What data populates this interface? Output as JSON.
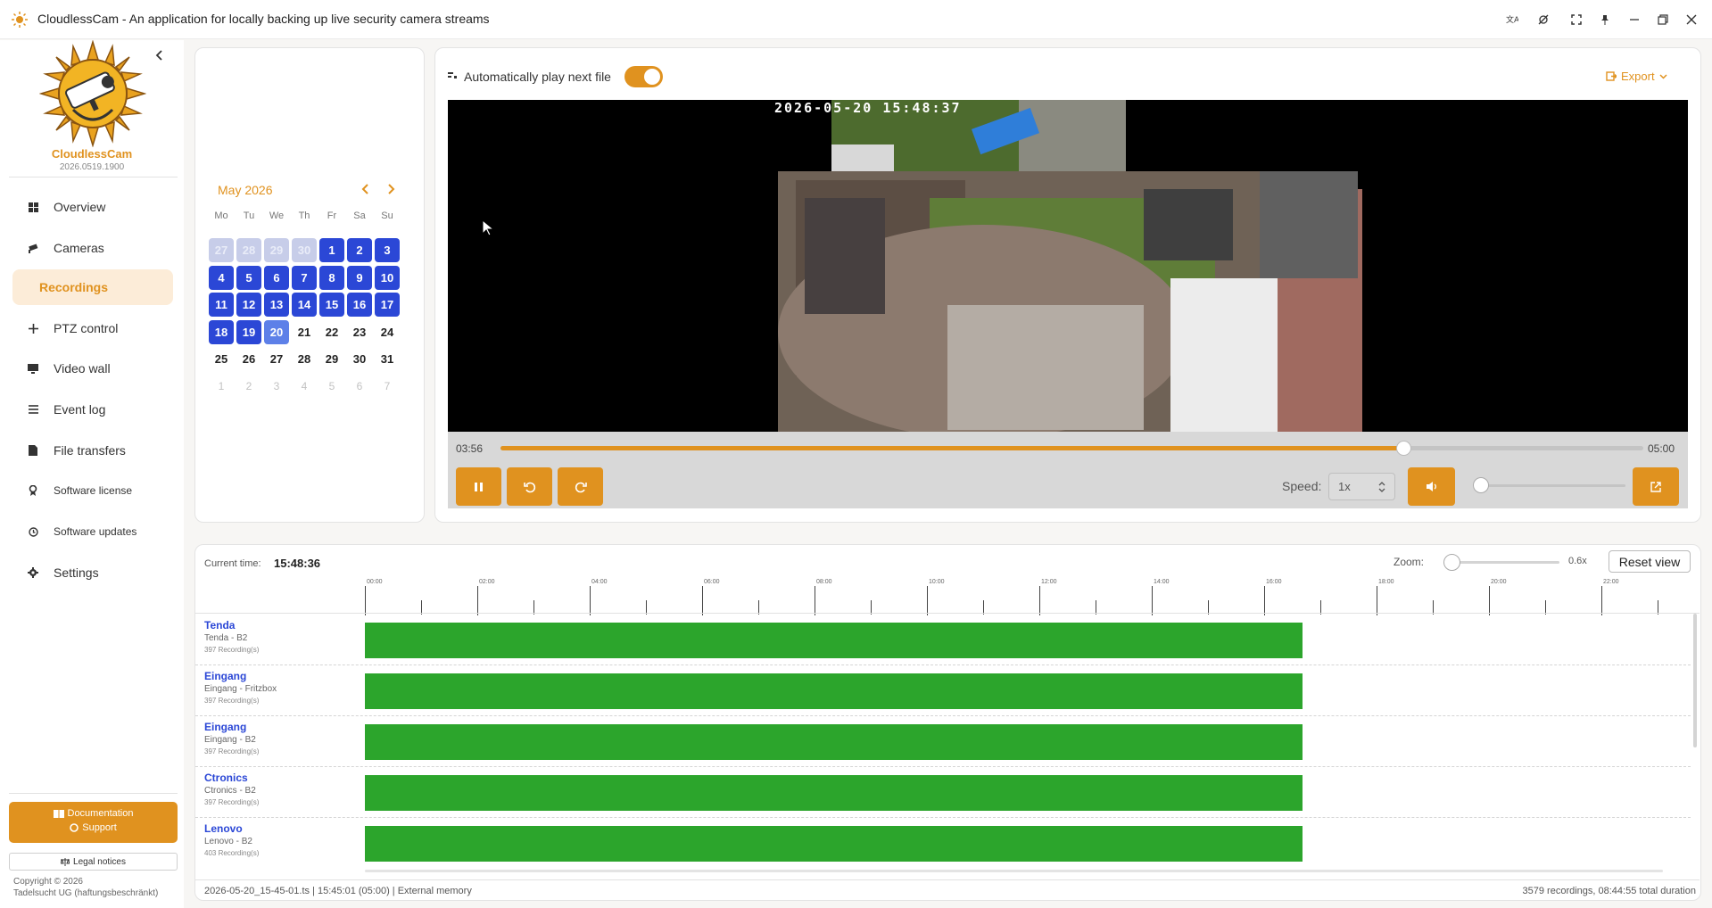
{
  "app": {
    "title": "CloudlessCam - An application for locally backing up live security camera streams"
  },
  "sidebar": {
    "brand": "CloudlessCam",
    "version": "2026.0519.1900",
    "items": [
      {
        "label": "Overview",
        "icon": "grid-icon"
      },
      {
        "label": "Cameras",
        "icon": "camera-icon"
      },
      {
        "label": "Recordings",
        "icon": "recordings-icon"
      },
      {
        "label": "PTZ control",
        "icon": "move-icon"
      },
      {
        "label": "Video wall",
        "icon": "monitor-icon"
      },
      {
        "label": "Event log",
        "icon": "list-icon"
      },
      {
        "label": "File transfers",
        "icon": "file-icon"
      },
      {
        "label": "Software license",
        "icon": "license-icon"
      },
      {
        "label": "Software updates",
        "icon": "update-icon"
      },
      {
        "label": "Settings",
        "icon": "gear-icon"
      }
    ],
    "documentation": "Documentation",
    "support": "Support",
    "legal": "Legal notices",
    "copyright1": "Copyright © 2026",
    "copyright2": "Tadelsucht UG (haftungsbeschränkt)"
  },
  "calendar": {
    "month": "May 2026",
    "weekdays": [
      "Mo",
      "Tu",
      "We",
      "Th",
      "Fr",
      "Sa",
      "Su"
    ],
    "weeks": [
      [
        "27",
        "28",
        "29",
        "30",
        "1",
        "2",
        "3"
      ],
      [
        "4",
        "5",
        "6",
        "7",
        "8",
        "9",
        "10"
      ],
      [
        "11",
        "12",
        "13",
        "14",
        "15",
        "16",
        "17"
      ],
      [
        "18",
        "19",
        "20",
        "21",
        "22",
        "23",
        "24"
      ],
      [
        "25",
        "26",
        "27",
        "28",
        "29",
        "30",
        "31"
      ],
      [
        "1",
        "2",
        "3",
        "4",
        "5",
        "6",
        "7"
      ]
    ],
    "selected": "20"
  },
  "player": {
    "autoplay_label": "Automatically play next file",
    "autoplay_on": true,
    "export_label": "Export",
    "overlay_timestamp": "2026-05-20 15:48:37",
    "elapsed": "03:56",
    "duration": "05:00",
    "progress": 0.79,
    "speed_label": "Speed:",
    "speed_value": "1x",
    "volume": 0.0
  },
  "timeline": {
    "current_time_label": "Current time:",
    "current_time": "15:48:36",
    "zoom_label": "Zoom:",
    "zoom_value": "0.6x",
    "reset_label": "Reset view",
    "hours": [
      "00:00",
      "02:00",
      "04:00",
      "06:00",
      "08:00",
      "10:00",
      "12:00",
      "14:00",
      "16:00",
      "18:00",
      "20:00",
      "22:00"
    ],
    "cameras": [
      {
        "name": "Tenda",
        "sub": "Tenda - B2",
        "count": "397 Recording(s)",
        "end_hour": 16.68
      },
      {
        "name": "Eingang",
        "sub": "Eingang - Fritzbox",
        "count": "397 Recording(s)",
        "end_hour": 16.68
      },
      {
        "name": "Eingang",
        "sub": "Eingang - B2",
        "count": "397 Recording(s)",
        "end_hour": 16.68
      },
      {
        "name": "Ctronics",
        "sub": "Ctronics - B2",
        "count": "397 Recording(s)",
        "end_hour": 16.68
      },
      {
        "name": "Lenovo",
        "sub": "Lenovo - B2",
        "count": "403 Recording(s)",
        "end_hour": 16.68
      }
    ]
  },
  "status": {
    "left": "2026-05-20_15-45-01.ts | 15:45:01 (05:00) | External memory",
    "right": "3579 recordings, 08:44:55 total duration"
  },
  "colors": {
    "accent": "#e0921f",
    "recording_day": "#2b47d6",
    "timeline_bar": "#2ca52c"
  }
}
